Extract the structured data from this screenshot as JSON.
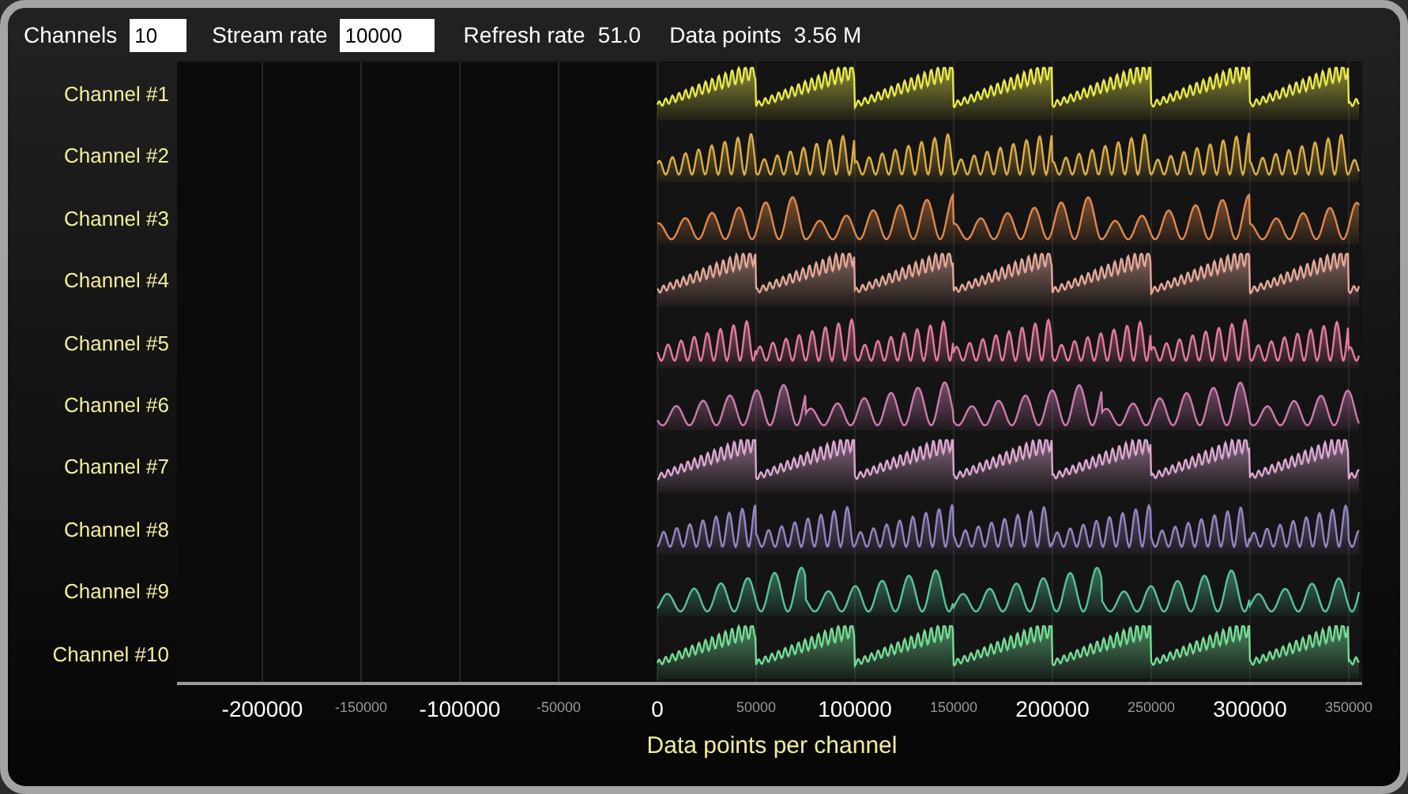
{
  "toolbar": {
    "channels": {
      "label": "Channels",
      "value": "10"
    },
    "stream_rate": {
      "label": "Stream rate",
      "value": "10000"
    },
    "refresh_rate": {
      "label": "Refresh rate",
      "value": "51.0"
    },
    "data_points": {
      "label": "Data points",
      "value": "3.56 M"
    }
  },
  "channels": [
    {
      "name": "Channel #1",
      "kind": "saw",
      "color": "#e8e84c"
    },
    {
      "name": "Channel #2",
      "kind": "sine",
      "color": "#dcae44"
    },
    {
      "name": "Channel #3",
      "kind": "wave",
      "color": "#e0884c"
    },
    {
      "name": "Channel #4",
      "kind": "saw",
      "color": "#e4a898"
    },
    {
      "name": "Channel #5",
      "kind": "sine",
      "color": "#e47aa0"
    },
    {
      "name": "Channel #6",
      "kind": "wave",
      "color": "#cc7cb0"
    },
    {
      "name": "Channel #7",
      "kind": "saw",
      "color": "#dca8d0"
    },
    {
      "name": "Channel #8",
      "kind": "sine",
      "color": "#9884c0"
    },
    {
      "name": "Channel #9",
      "kind": "wave",
      "color": "#58c498"
    },
    {
      "name": "Channel #10",
      "kind": "saw",
      "color": "#74dc94"
    }
  ],
  "x_axis": {
    "title": "Data points per channel",
    "ticks": [
      {
        "label": "-200000",
        "major": true
      },
      {
        "label": "-150000",
        "major": false
      },
      {
        "label": "-100000",
        "major": true
      },
      {
        "label": "-50000",
        "major": false
      },
      {
        "label": "0",
        "major": true
      },
      {
        "label": "50000",
        "major": false
      },
      {
        "label": "100000",
        "major": true
      },
      {
        "label": "150000",
        "major": false
      },
      {
        "label": "200000",
        "major": true
      },
      {
        "label": "250000",
        "major": false
      },
      {
        "label": "300000",
        "major": true
      },
      {
        "label": "350000",
        "major": false
      }
    ]
  }
}
